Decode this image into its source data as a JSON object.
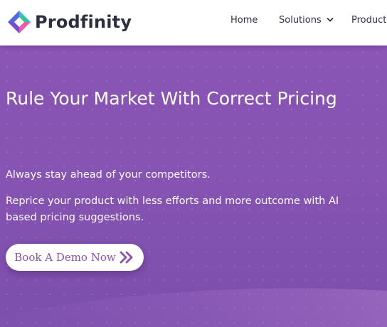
{
  "brand": {
    "name": "Prodfinity",
    "logo_icon": "prodfinity-logo-icon"
  },
  "nav": {
    "items": [
      {
        "label": "Home"
      },
      {
        "label": "Solutions",
        "icon": "chevron-down-icon"
      },
      {
        "label": "Product"
      }
    ]
  },
  "hero": {
    "title": "Rule Your Market With Correct Pricing",
    "tagline": "Always stay ahead of your competitors.",
    "description": "Reprice your product with less efforts and more outcome with AI based pricing suggestions.",
    "cta_label": "Book A Demo Now",
    "cta_icon": "double-chevron-right-icon"
  },
  "colors": {
    "hero_background": "#8754b2",
    "header_background": "#ffffff",
    "brand_text": "#2b2f3f",
    "cta_text": "#8e4fad",
    "logo_green": "#2fc7a1",
    "logo_blue": "#4f6be0",
    "logo_pink": "#ef5aa3",
    "logo_purple": "#7a4bd0"
  }
}
